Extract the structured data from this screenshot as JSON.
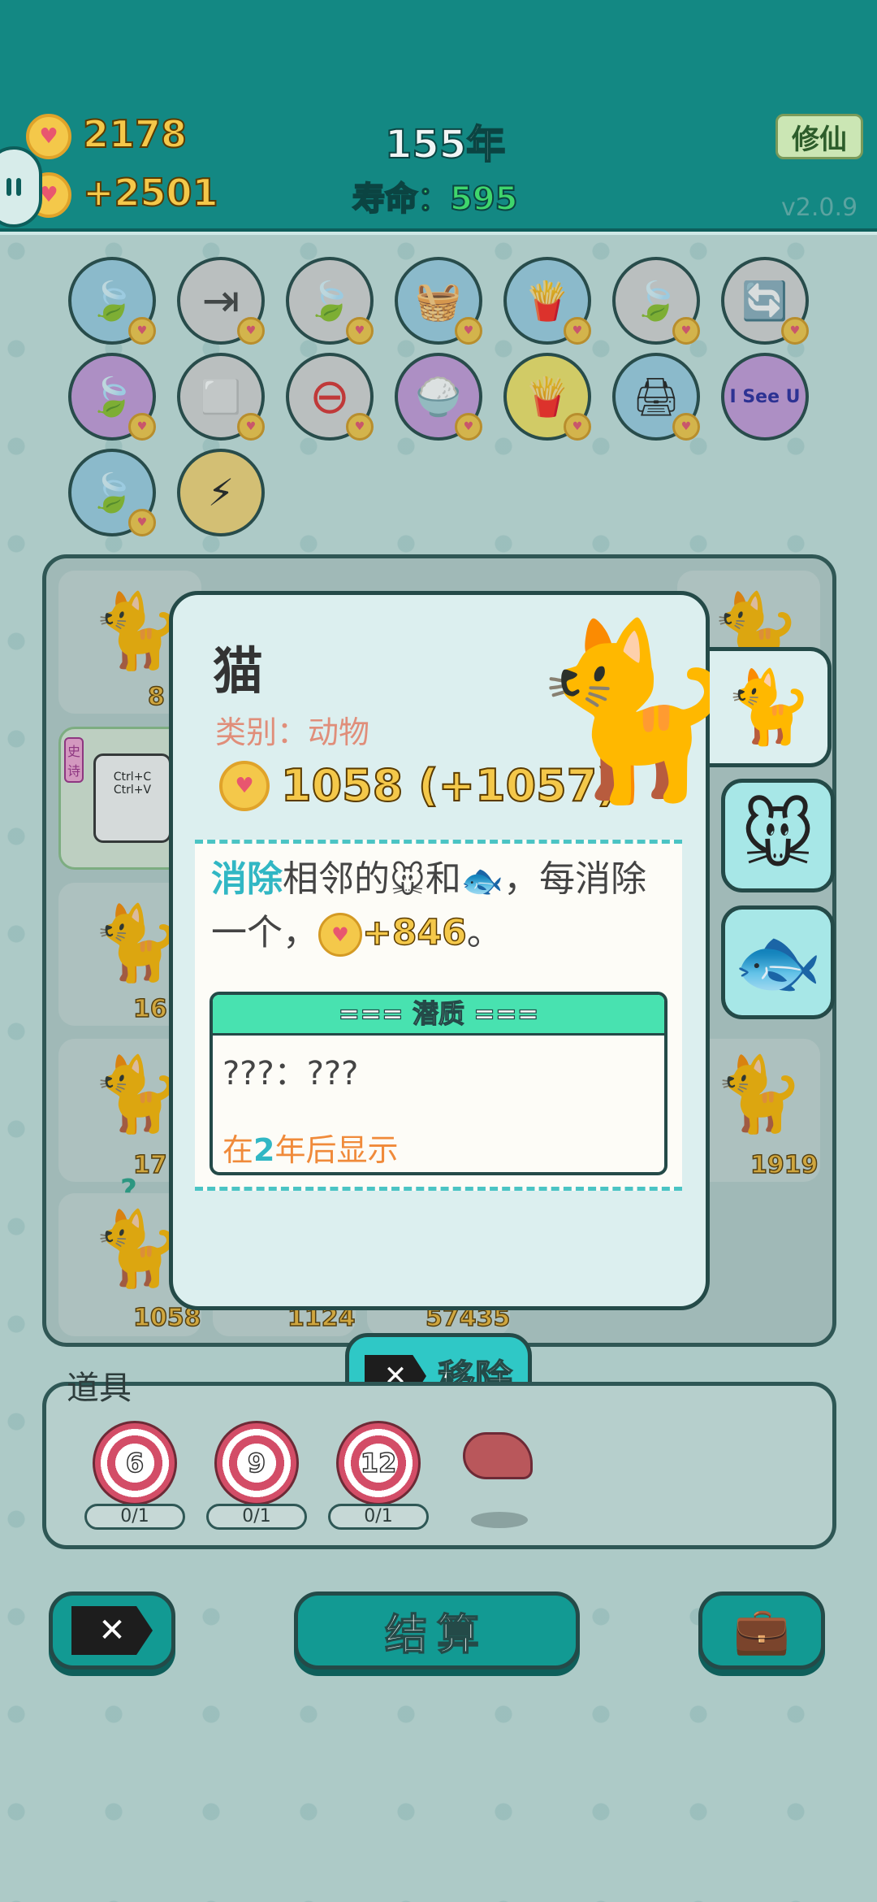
{
  "header": {
    "coins": "2178",
    "income": "+2501",
    "year": "155年",
    "lifespan": "寿命：595",
    "xiuxian_label": "修仙",
    "version": "v2.0.9"
  },
  "buffs": [
    {
      "icon": "leaf-icon",
      "glyph": "🍃",
      "color": "blue"
    },
    {
      "icon": "skip-icon",
      "glyph": "⇥",
      "color": "gray"
    },
    {
      "icon": "leaf-icon",
      "glyph": "🍃",
      "color": "gray"
    },
    {
      "icon": "fruit-basket-icon",
      "glyph": "🧺",
      "color": "blue"
    },
    {
      "icon": "fries-icon",
      "glyph": "🍟",
      "color": "blue"
    },
    {
      "icon": "leaf-icon",
      "glyph": "🍃",
      "color": "gray"
    },
    {
      "icon": "refresh-icon",
      "glyph": "🔄",
      "color": "gray"
    },
    {
      "icon": "leaf-icon",
      "glyph": "🍃",
      "color": "purple"
    },
    {
      "icon": "cubes-icon",
      "glyph": "⬜",
      "color": "gray"
    },
    {
      "icon": "minus-circle-icon",
      "glyph": "⊖",
      "color": "gray"
    },
    {
      "icon": "rice-bowl-icon",
      "glyph": "🍚",
      "color": "purple"
    },
    {
      "icon": "fries-icon",
      "glyph": "🍟",
      "color": "yellow"
    },
    {
      "icon": "printer-icon",
      "glyph": "🖨",
      "color": "blue"
    },
    {
      "icon": "i-see-u-icon",
      "glyph": "I See U",
      "color": "purple"
    },
    {
      "icon": "leaf-icon",
      "glyph": "🍃",
      "color": "blue"
    },
    {
      "icon": "lightning-icon",
      "glyph": "⚡",
      "color": "gold"
    }
  ],
  "board": {
    "cells": [
      {
        "label": "8",
        "has_cat": true
      },
      {
        "label": "16",
        "has_cat": true
      },
      {
        "label": "17",
        "has_cat": true
      },
      {
        "label": "1058",
        "has_cat": true
      },
      {
        "label": "1124",
        "has_cat": false
      },
      {
        "label": "57435",
        "has_cat": false
      },
      {
        "label": "1919",
        "has_cat": true
      }
    ],
    "legend_tag": "史诗",
    "clipboard_text": "Ctrl+C\nCtrl+V",
    "question_mark": "?"
  },
  "card": {
    "title": "猫",
    "category": "类别：动物",
    "value": "1058 (+1057)",
    "desc_hl": "消除",
    "desc_part1": "相邻的",
    "desc_and": "和",
    "desc_part2": "，每消除一个，",
    "desc_bonus": "+846",
    "desc_end": "。",
    "potential_title": "=== 潜质 ===",
    "potential_value": "???：???",
    "reveal_pre": "在",
    "reveal_num": "2",
    "reveal_post": "年后显示"
  },
  "tabs": [
    {
      "icon": "cat-icon",
      "glyph": "🐈"
    },
    {
      "icon": "mouse-icon",
      "glyph": "🐭"
    },
    {
      "icon": "fish-icon",
      "glyph": "🐟"
    }
  ],
  "actions": {
    "remove_label": "移除",
    "settle_label": "结算"
  },
  "tools": {
    "title": "道具",
    "items": [
      {
        "value": "6",
        "count": "0/1"
      },
      {
        "value": "9",
        "count": "0/1"
      },
      {
        "value": "12",
        "count": "0/1"
      }
    ]
  }
}
